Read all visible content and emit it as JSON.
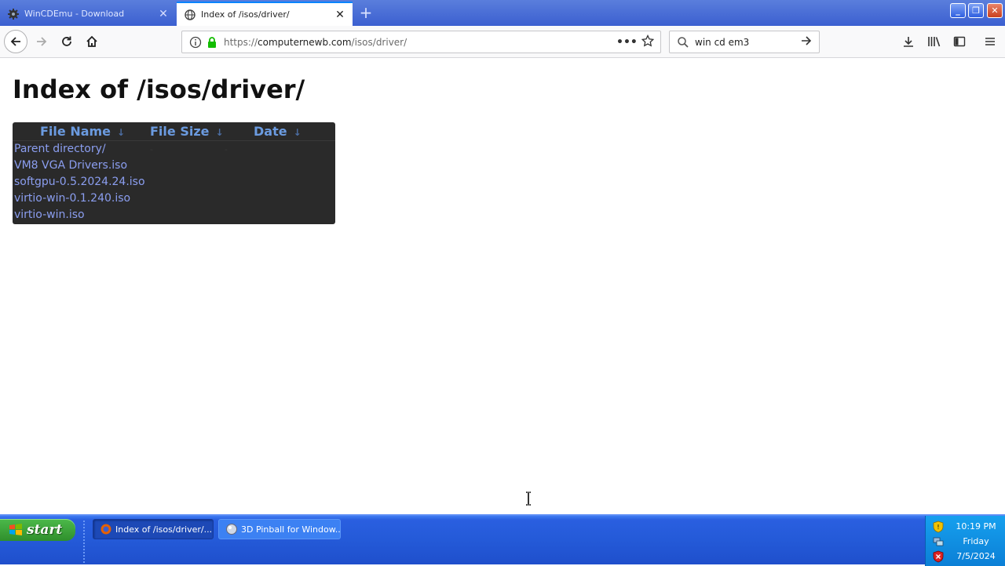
{
  "browser": {
    "tabs": [
      {
        "title": "WinCDEmu - Download",
        "icon": "gear-icon",
        "active": false
      },
      {
        "title": "Index of /isos/driver/",
        "icon": "globe-icon",
        "active": true
      }
    ],
    "url_prefix": "https://",
    "url_host": "computernewb.com",
    "url_path": "/isos/driver/",
    "search_value": "win cd em3"
  },
  "page": {
    "heading": "Index of /isos/driver/",
    "columns": [
      "File Name",
      "File Size",
      "Date"
    ],
    "sort_arrow": "↓",
    "rows": [
      {
        "name": "Parent directory/",
        "size": "-",
        "date": "-"
      },
      {
        "name": "VM8 VGA Drivers.iso",
        "size": "",
        "date": ""
      },
      {
        "name": "softgpu-0.5.2024.24.iso",
        "size": "",
        "date": ""
      },
      {
        "name": "virtio-win-0.1.240.iso",
        "size": "",
        "date": ""
      },
      {
        "name": "virtio-win.iso",
        "size": "",
        "date": ""
      }
    ]
  },
  "taskbar": {
    "start_label": "start",
    "tasks": [
      {
        "label": "Index of /isos/driver/..."
      },
      {
        "label": "3D Pinball for Window..."
      }
    ],
    "clock_time": "10:19 PM",
    "clock_day": "Friday",
    "clock_date": "7/5/2024"
  },
  "colors": {
    "accent": "#0a84ff",
    "taskbar_blue": "#245ad8",
    "start_green": "#3a9e37",
    "listing_bg": "#2a2a2a",
    "link": "#8b9ef0"
  }
}
